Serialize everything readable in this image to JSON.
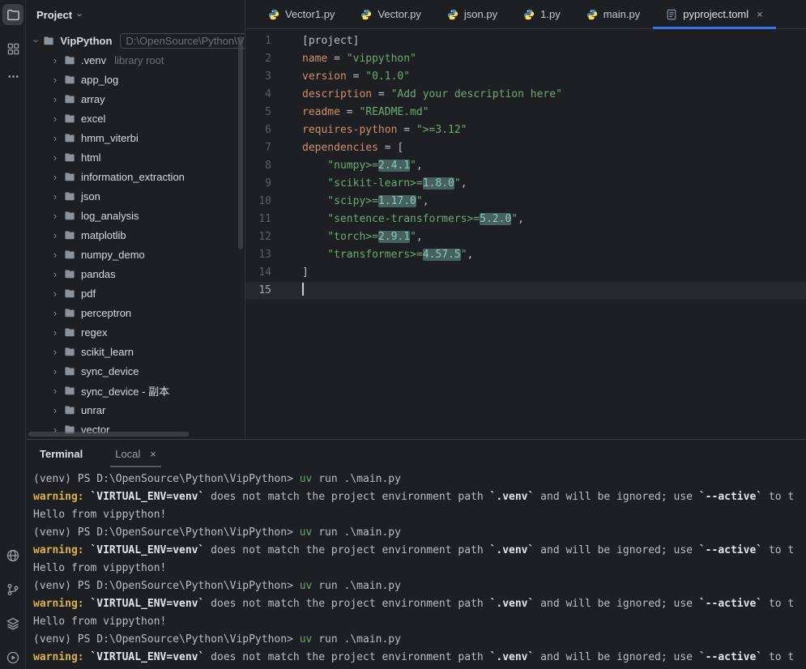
{
  "icons": {
    "chevron": "›",
    "close": "×"
  },
  "colors": {
    "background": "#1e1f22",
    "accent_blue": "#3574f0",
    "string_green": "#6aab73",
    "key_orange": "#cf8e6d",
    "warning_yellow": "#d9b44a",
    "uv_green": "#5fad65",
    "version_highlight_bg": "#45635c"
  },
  "stripe": {
    "top_icons": [
      "project-folder-icon",
      "grid-icon",
      "more-icon"
    ],
    "bottom_icons": [
      "globe-icon",
      "git-branch-icon",
      "layers-icon",
      "run-icon"
    ]
  },
  "project_panel": {
    "header_label": "Project",
    "root": {
      "name": "VipPython",
      "path_suffix": "D:\\OpenSource\\Python\\Vi"
    },
    "items": [
      {
        "label": ".venv",
        "annotation": "library root"
      },
      {
        "label": "app_log"
      },
      {
        "label": "array"
      },
      {
        "label": "excel"
      },
      {
        "label": "hmm_viterbi"
      },
      {
        "label": "html"
      },
      {
        "label": "information_extraction"
      },
      {
        "label": "json"
      },
      {
        "label": "log_analysis"
      },
      {
        "label": "matplotlib"
      },
      {
        "label": "numpy_demo"
      },
      {
        "label": "pandas"
      },
      {
        "label": "pdf"
      },
      {
        "label": "perceptron"
      },
      {
        "label": "regex"
      },
      {
        "label": "scikit_learn"
      },
      {
        "label": "sync_device"
      },
      {
        "label": "sync_device - 副本"
      },
      {
        "label": "unrar"
      },
      {
        "label": "vector"
      }
    ]
  },
  "editor_tabs": [
    {
      "label": "Vector1.py",
      "icon": "python"
    },
    {
      "label": "Vector.py",
      "icon": "python"
    },
    {
      "label": "json.py",
      "icon": "python"
    },
    {
      "label": "1.py",
      "icon": "python"
    },
    {
      "label": "main.py",
      "icon": "python"
    },
    {
      "label": "pyproject.toml",
      "icon": "toml",
      "active": true,
      "closable": true
    }
  ],
  "editor": {
    "lines": [
      {
        "num": "1",
        "tokens": [
          {
            "t": "[project]",
            "c": "plain"
          }
        ]
      },
      {
        "num": "2",
        "tokens": [
          {
            "t": "name",
            "c": "key"
          },
          {
            "t": " = ",
            "c": "plain"
          },
          {
            "t": "\"vippython\"",
            "c": "str"
          }
        ]
      },
      {
        "num": "3",
        "tokens": [
          {
            "t": "version",
            "c": "key"
          },
          {
            "t": " = ",
            "c": "plain"
          },
          {
            "t": "\"0.1.0\"",
            "c": "str"
          }
        ]
      },
      {
        "num": "4",
        "tokens": [
          {
            "t": "description",
            "c": "key"
          },
          {
            "t": " = ",
            "c": "plain"
          },
          {
            "t": "\"Add your description here\"",
            "c": "str"
          }
        ]
      },
      {
        "num": "5",
        "tokens": [
          {
            "t": "readme",
            "c": "key"
          },
          {
            "t": " = ",
            "c": "plain"
          },
          {
            "t": "\"README.md\"",
            "c": "str"
          }
        ]
      },
      {
        "num": "6",
        "tokens": [
          {
            "t": "requires-python",
            "c": "key"
          },
          {
            "t": " = ",
            "c": "plain"
          },
          {
            "t": "\">=3.12\"",
            "c": "str"
          }
        ]
      },
      {
        "num": "7",
        "tokens": [
          {
            "t": "dependencies",
            "c": "key"
          },
          {
            "t": " = [",
            "c": "plain"
          }
        ]
      },
      {
        "num": "8",
        "tokens": [
          {
            "t": "    \"numpy>=",
            "c": "str"
          },
          {
            "t": "2.4.1",
            "c": "hl"
          },
          {
            "t": "\"",
            "c": "str"
          },
          {
            "t": ",",
            "c": "plain"
          }
        ]
      },
      {
        "num": "9",
        "tokens": [
          {
            "t": "    \"scikit-learn>=",
            "c": "str"
          },
          {
            "t": "1.8.0",
            "c": "hl"
          },
          {
            "t": "\"",
            "c": "str"
          },
          {
            "t": ",",
            "c": "plain"
          }
        ]
      },
      {
        "num": "10",
        "tokens": [
          {
            "t": "    \"scipy>=",
            "c": "str"
          },
          {
            "t": "1.17.0",
            "c": "hl"
          },
          {
            "t": "\"",
            "c": "str"
          },
          {
            "t": ",",
            "c": "plain"
          }
        ]
      },
      {
        "num": "11",
        "tokens": [
          {
            "t": "    \"sentence-transformers>=",
            "c": "str"
          },
          {
            "t": "5.2.0",
            "c": "hl"
          },
          {
            "t": "\"",
            "c": "str"
          },
          {
            "t": ",",
            "c": "plain"
          }
        ]
      },
      {
        "num": "12",
        "tokens": [
          {
            "t": "    \"torch>=",
            "c": "str"
          },
          {
            "t": "2.9.1",
            "c": "hl"
          },
          {
            "t": "\"",
            "c": "str"
          },
          {
            "t": ",",
            "c": "plain"
          }
        ]
      },
      {
        "num": "13",
        "tokens": [
          {
            "t": "    \"transformers>=",
            "c": "str"
          },
          {
            "t": "4.57.5",
            "c": "hl"
          },
          {
            "t": "\"",
            "c": "str"
          },
          {
            "t": ",",
            "c": "plain"
          }
        ]
      },
      {
        "num": "14",
        "tokens": [
          {
            "t": "]",
            "c": "plain"
          }
        ]
      },
      {
        "num": "15",
        "tokens": [],
        "current": true,
        "caret": true
      }
    ]
  },
  "terminal": {
    "panel_title": "Terminal",
    "tab_label": "Local",
    "line_types": {
      "prompt": [
        {
          "t": "(venv) PS D:\\OpenSource\\Python\\VipPython> ",
          "c": "plain"
        },
        {
          "t": "uv",
          "c": "green"
        },
        {
          "t": " run .\\main.py",
          "c": "plain"
        }
      ],
      "warning": [
        {
          "t": "warning:",
          "c": "yellow"
        },
        {
          "t": " ",
          "c": "plain"
        },
        {
          "t": "`VIRTUAL_ENV=venv`",
          "c": "bold"
        },
        {
          "t": " does not match the project environment path ",
          "c": "plain"
        },
        {
          "t": "`.venv`",
          "c": "bold"
        },
        {
          "t": " and will be ignored; use ",
          "c": "plain"
        },
        {
          "t": "`--active`",
          "c": "bold"
        },
        {
          "t": " to t",
          "c": "plain"
        }
      ],
      "hello": [
        {
          "t": "Hello from vippython!",
          "c": "plain"
        }
      ]
    },
    "sequence": [
      "prompt",
      "warning",
      "hello",
      "prompt",
      "warning",
      "hello",
      "prompt",
      "warning",
      "hello",
      "prompt",
      "warning"
    ]
  }
}
